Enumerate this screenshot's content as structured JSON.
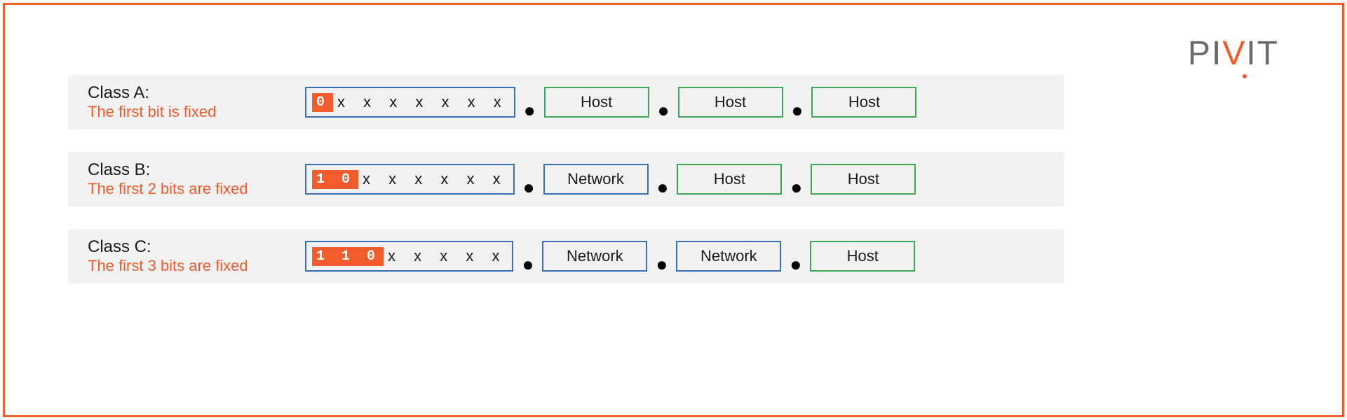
{
  "brand": {
    "name": "PIVIT",
    "p1": "P",
    "i1": "I",
    "v": "V",
    "i2": "I",
    "t": "T"
  },
  "classes": [
    {
      "title": "Class A:",
      "subtitle": "The first bit is fixed",
      "fixed_bits": "0",
      "var_bits": "x x x x x x x",
      "octets": [
        "Host",
        "Host",
        "Host"
      ],
      "octet_types": [
        "host",
        "host",
        "host"
      ]
    },
    {
      "title": "Class B:",
      "subtitle": "The first 2 bits are fixed",
      "fixed_bits": "1 0",
      "var_bits": "x x x x x x",
      "octets": [
        "Network",
        "Host",
        "Host"
      ],
      "octet_types": [
        "network",
        "host",
        "host"
      ]
    },
    {
      "title": "Class C:",
      "subtitle": "The first 3 bits are fixed",
      "fixed_bits": "1 1 0",
      "var_bits": "x x x x x",
      "octets": [
        "Network",
        "Network",
        "Host"
      ],
      "octet_types": [
        "network",
        "network",
        "host"
      ]
    }
  ],
  "colors": {
    "accent": "#f25c2c",
    "network_border": "#3b6fb5",
    "host_border": "#3fa857",
    "row_bg": "#f2f2f2"
  }
}
